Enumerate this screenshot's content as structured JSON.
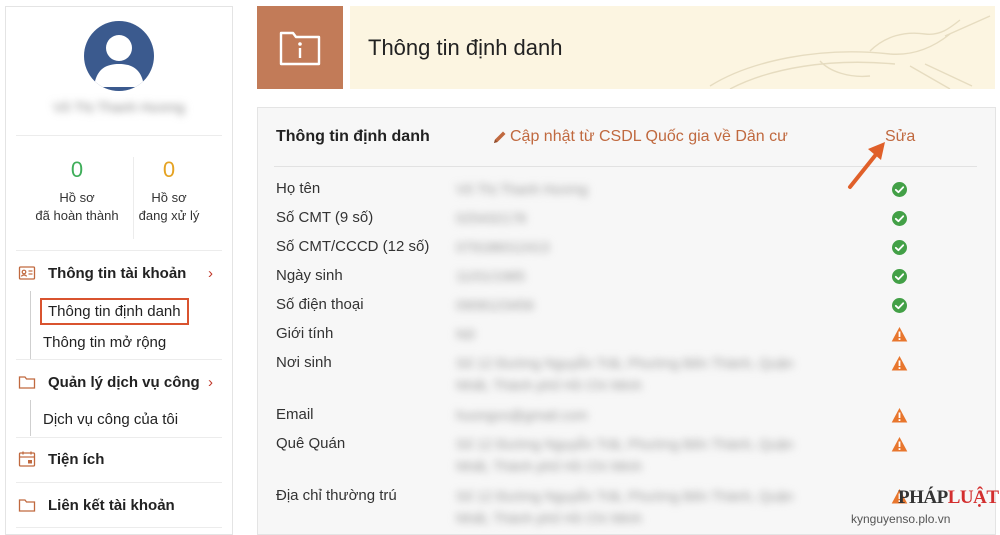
{
  "sidebar": {
    "user_name": "Võ Thị Thanh Hương",
    "stats": [
      {
        "value": "0",
        "label_line1": "Hồ sơ",
        "label_line2": "đã hoàn thành",
        "color": "#3fae5a"
      },
      {
        "value": "0",
        "label_line1": "Hồ sơ",
        "label_line2": "đang xử lý",
        "color": "#e5a323"
      }
    ],
    "menu": {
      "account": {
        "label": "Thông tin tài khoản",
        "icon": "id-card-icon"
      },
      "account_identity": "Thông tin định danh",
      "account_extended": "Thông tin mở rộng",
      "services": {
        "label": "Quản lý dịch vụ công",
        "icon": "folder-icon"
      },
      "services_mine": "Dịch vụ công của tôi",
      "utilities": {
        "label": "Tiện ích",
        "icon": "calendar-icon"
      },
      "link_account": {
        "label": "Liên kết tài khoản",
        "icon": "folder-icon"
      },
      "chevron": "›"
    }
  },
  "header": {
    "title": "Thông tin định danh",
    "icon": "folder-info-icon",
    "icon_bg": "#c27b58",
    "banner_bg": "#fcf5e1"
  },
  "panel": {
    "title": "Thông tin định danh",
    "update_link": "Cập nhật từ CSDL Quốc gia về Dân cư",
    "edit_link": "Sửa",
    "accent_color": "#c0693f",
    "fields": [
      {
        "label": "Họ tên",
        "value": "Võ Thị Thanh Hương",
        "status": "verified"
      },
      {
        "label": "Số CMT (9 số)",
        "value": "025432178",
        "status": "verified"
      },
      {
        "label": "Số CMT/CCCD (12 số)",
        "value": "079186012413",
        "status": "verified"
      },
      {
        "label": "Ngày sinh",
        "value": "11/01/1985",
        "status": "verified"
      },
      {
        "label": "Số điện thoại",
        "value": "0908123456",
        "status": "verified"
      },
      {
        "label": "Giới tính",
        "value": "Nữ",
        "status": "warning"
      },
      {
        "label": "Nơi sinh",
        "value": "Số 12 Đường Nguyễn Trãi, Phường Bến Thành, Quận",
        "value2": "Nhất, Thành phố Hồ Chí Minh",
        "status": "warning"
      },
      {
        "label": "Email",
        "value": "huongvo@gmail.com",
        "status": "warning"
      },
      {
        "label": "Quê Quán",
        "value": "Số 12 Đường Nguyễn Trãi, Phường Bến Thành, Quận",
        "value2": "Nhất, Thành phố Hồ Chí Minh",
        "status": "warning"
      },
      {
        "label": "Địa chỉ thường trú",
        "value": "Số 12 Đường Nguyễn Trãi, Phường Bến Thành, Quận",
        "value2": "Nhất, Thành phố Hồ Chí Minh",
        "status": "warning"
      }
    ],
    "status_colors": {
      "verified": "#43a047",
      "warning": "#e8762d"
    }
  },
  "watermark": {
    "logo_part1": "PHÁP",
    "logo_part2": "LUẬT",
    "url": "kynguyenso.plo.vn"
  }
}
